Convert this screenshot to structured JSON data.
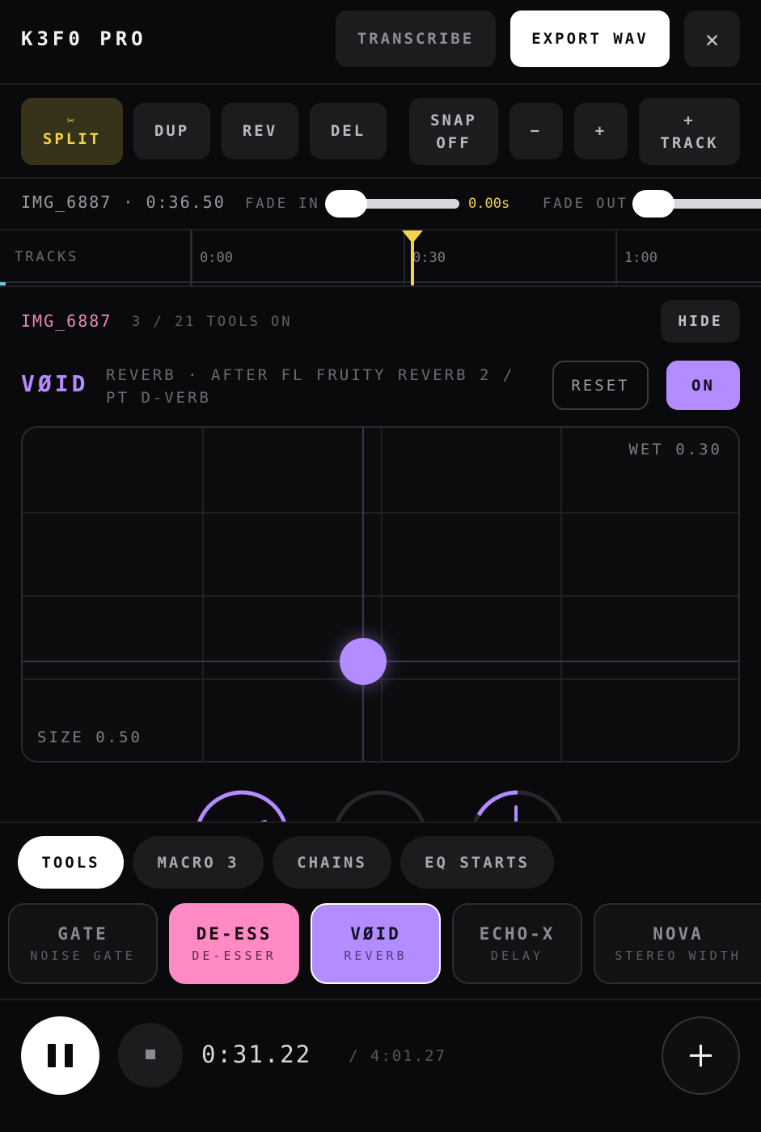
{
  "header": {
    "app_title": "K3F0 PRO",
    "transcribe_label": "TRANSCRIBE",
    "export_label": "EXPORT WAV",
    "close_glyph": "✕"
  },
  "toolbar": {
    "split_icon": "✂",
    "split_label": "SPLIT",
    "dup_label": "DUP",
    "rev_label": "REV",
    "del_label": "DEL",
    "snap_line1": "SNAP",
    "snap_line2": "OFF",
    "zoom_out_label": "−",
    "zoom_in_label": "+",
    "add_track_line1": "+",
    "add_track_line2": "TRACK"
  },
  "clip_row": {
    "clip_info": "IMG_6887 · 0:36.50",
    "fade_in_label": "FADE IN",
    "fade_in_value": "0.00s",
    "fade_out_label": "FADE OUT"
  },
  "timeline": {
    "tracks_label": "TRACKS",
    "ticks": [
      "0:00",
      "0:30",
      "1:00"
    ]
  },
  "fx": {
    "clip_name": "IMG_6887",
    "tools_on": "3 / 21 TOOLS ON",
    "hide_label": "HIDE",
    "plugin_name": "VØID",
    "plugin_desc": "REVERB · AFTER FL FRUITY REVERB 2 / PT D-VERB",
    "reset_label": "RESET",
    "on_label": "ON",
    "xy": {
      "wet_label": "WET 0.30",
      "size_label": "SIZE 0.50",
      "x_value": 0.5,
      "y_value": 0.3
    }
  },
  "bottom": {
    "tabs": [
      {
        "label": "TOOLS",
        "active": true
      },
      {
        "label": "MACRO 3",
        "active": false
      },
      {
        "label": "CHAINS",
        "active": false
      },
      {
        "label": "EQ STARTS",
        "active": false
      }
    ],
    "tools": [
      {
        "name": "GATE",
        "sub": "NOISE GATE"
      },
      {
        "name": "DE-ESS",
        "sub": "DE-ESSER"
      },
      {
        "name": "VØID",
        "sub": "REVERB"
      },
      {
        "name": "ECHO-X",
        "sub": "DELAY"
      },
      {
        "name": "NOVA",
        "sub": "STEREO WIDTH"
      }
    ],
    "time_current": "0:31.22",
    "time_total": "/ 4:01.27",
    "add_glyph": "+"
  },
  "colors": {
    "accent_purple": "#b38cff",
    "accent_pink": "#ff8ac4",
    "accent_yellow": "#f3d34a",
    "background": "#0a0a0c"
  }
}
